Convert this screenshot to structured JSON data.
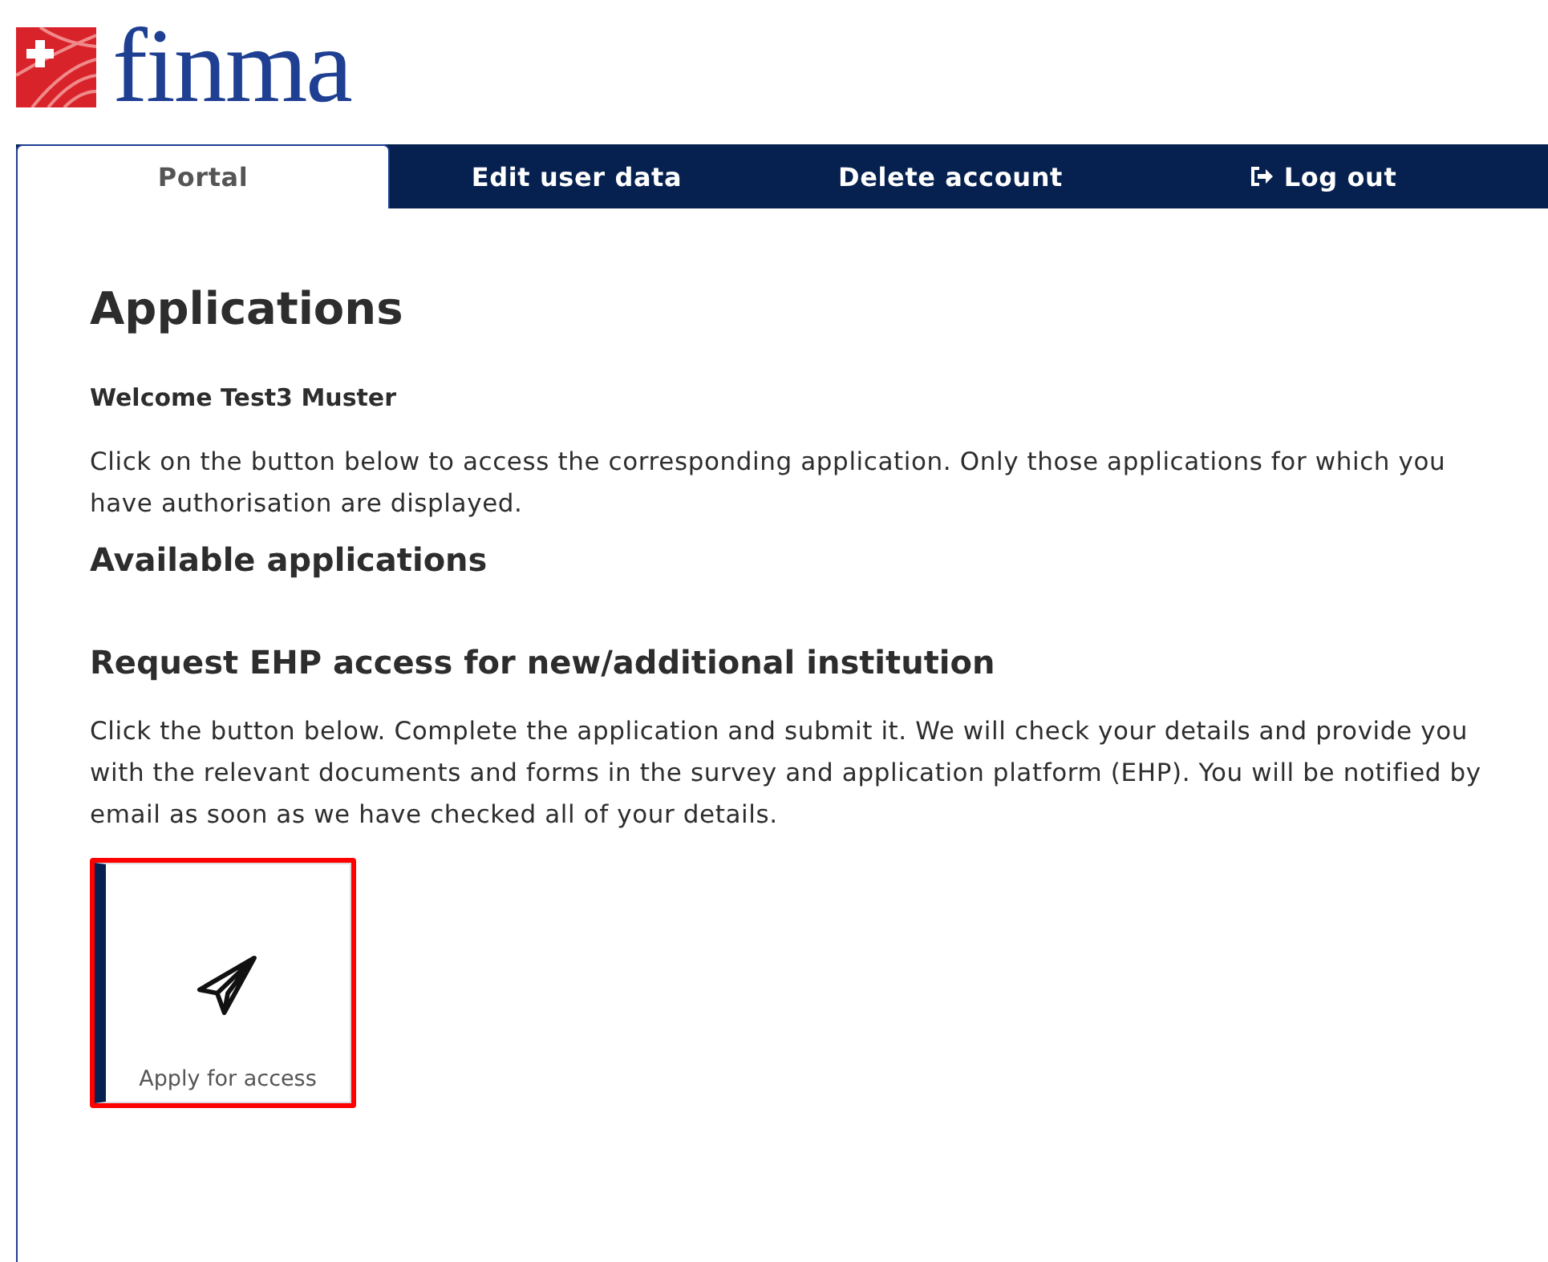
{
  "logo": {
    "wordmark": "finma"
  },
  "tabs": [
    {
      "label": "Portal",
      "selected": true,
      "kind": "plain"
    },
    {
      "label": "Edit user data",
      "selected": false,
      "kind": "plain"
    },
    {
      "label": "Delete account",
      "selected": false,
      "kind": "plain"
    },
    {
      "label": "Log out",
      "selected": false,
      "kind": "logout"
    }
  ],
  "page_title": "Applications",
  "welcome": "Welcome Test3 Muster",
  "intro": "Click on the button below to access the corresponding application. Only those applications for which you have authorisation are displayed.",
  "available_heading": "Available applications",
  "section": {
    "heading": "Request EHP access for new/additional institution",
    "text": "Click the button below. Complete the application and submit it. We will check your details and provide you with the relevant documents and forms in the survey and application platform (EHP). You will be notified by email as soon as we have checked all of your details.",
    "tile": {
      "label": "Apply for access",
      "highlighted": true
    }
  }
}
